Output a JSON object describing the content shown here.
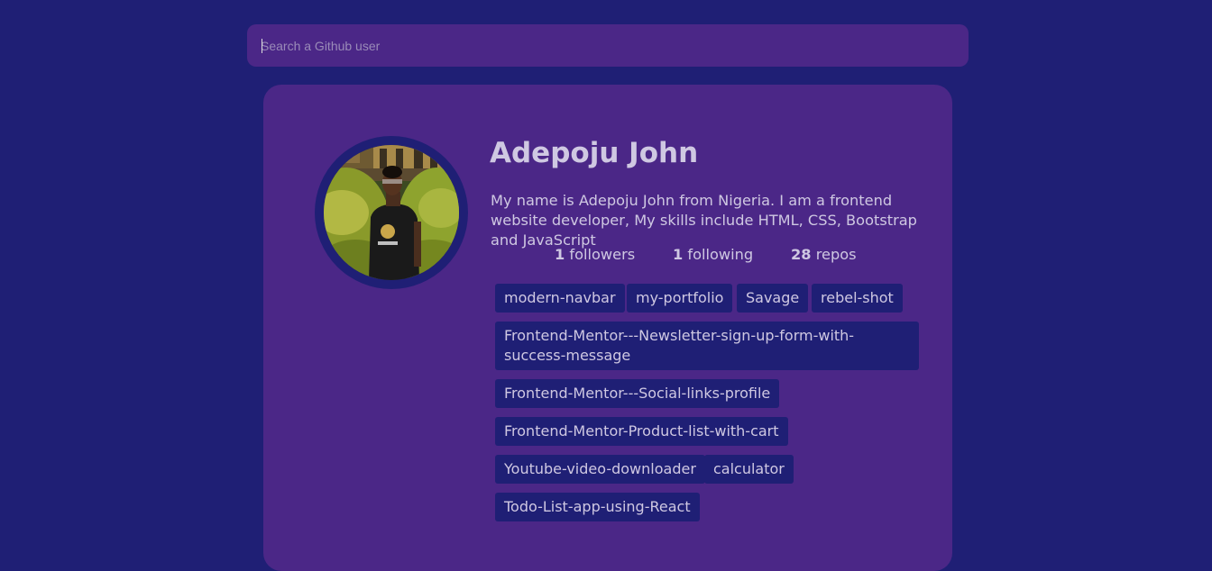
{
  "search": {
    "placeholder": "Search a Github user",
    "value": ""
  },
  "profile": {
    "name": "Adepoju John",
    "bio": "My name is Adepoju John from Nigeria. I am a frontend website developer, My skills include HTML, CSS, Bootstrap and JavaScript",
    "avatar_icon": "user-photo",
    "stats": {
      "followers_count": "1",
      "followers_label": "followers",
      "following_count": "1",
      "following_label": "following",
      "repos_count": "28",
      "repos_label": "repos"
    }
  },
  "repos": [
    "modern-navbar",
    "my-portfolio",
    "Savage",
    "rebel-shot",
    "Frontend-Mentor---Newsletter-sign-up-form-with-success-message",
    "Frontend-Mentor---Social-links-profile",
    "Frontend-Mentor-Product-list-with-cart",
    "Youtube-video-downloader",
    "calculator",
    "Todo-List-app-using-React"
  ],
  "colors": {
    "background": "#1f1f75",
    "card": "#4b2787",
    "text": "#cfc8e2"
  }
}
